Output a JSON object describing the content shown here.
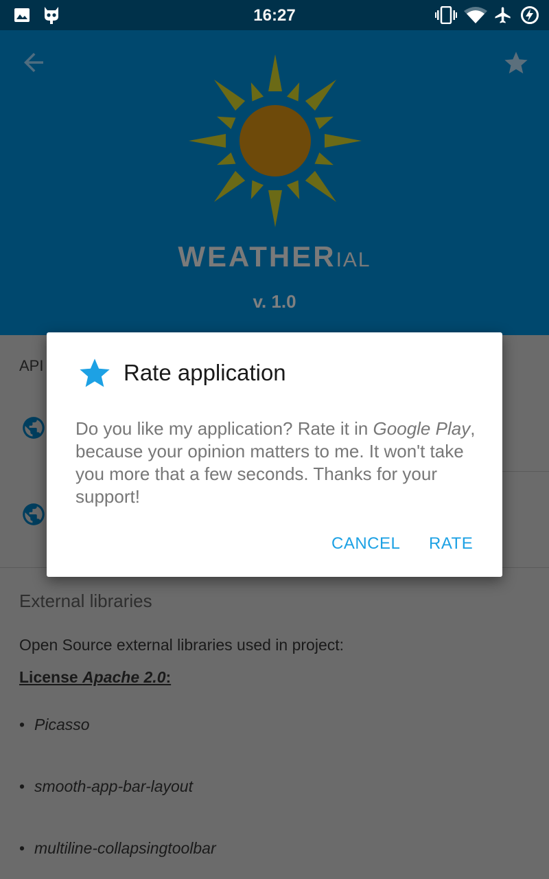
{
  "status_bar": {
    "time": "16:27",
    "left_icons": [
      "image-icon",
      "cyanogen-bot-icon"
    ],
    "right_icons": [
      "vibrate-icon",
      "wifi-icon",
      "airplane-mode-icon",
      "battery-charging-icon"
    ]
  },
  "header": {
    "brand": "WEATHER",
    "brand_suffix": "IAL",
    "version": "v. 1.0",
    "background_color": "#00486e",
    "nav_icon": "back-arrow-icon",
    "action_icon": "star-icon"
  },
  "content": {
    "api_label": "API",
    "external_libraries": {
      "title": "External libraries",
      "description": "Open Source external libraries used in project:",
      "license_prefix": "License ",
      "license_name": "Apache 2.0",
      "license_suffix": ":",
      "libraries": [
        "Picasso",
        "smooth-app-bar-layout",
        "multiline-collapsingtoolbar"
      ]
    }
  },
  "dialog": {
    "title": "Rate application",
    "icon": "star-icon",
    "message_part1": "Do you like my application? Rate it in ",
    "message_em": "Google Play",
    "message_part2": ", because your opinion matters to me. It won't take you more that a few seconds. Thanks for your support!",
    "cancel_label": "CANCEL",
    "rate_label": "RATE",
    "accent_color": "#1da1e4"
  }
}
